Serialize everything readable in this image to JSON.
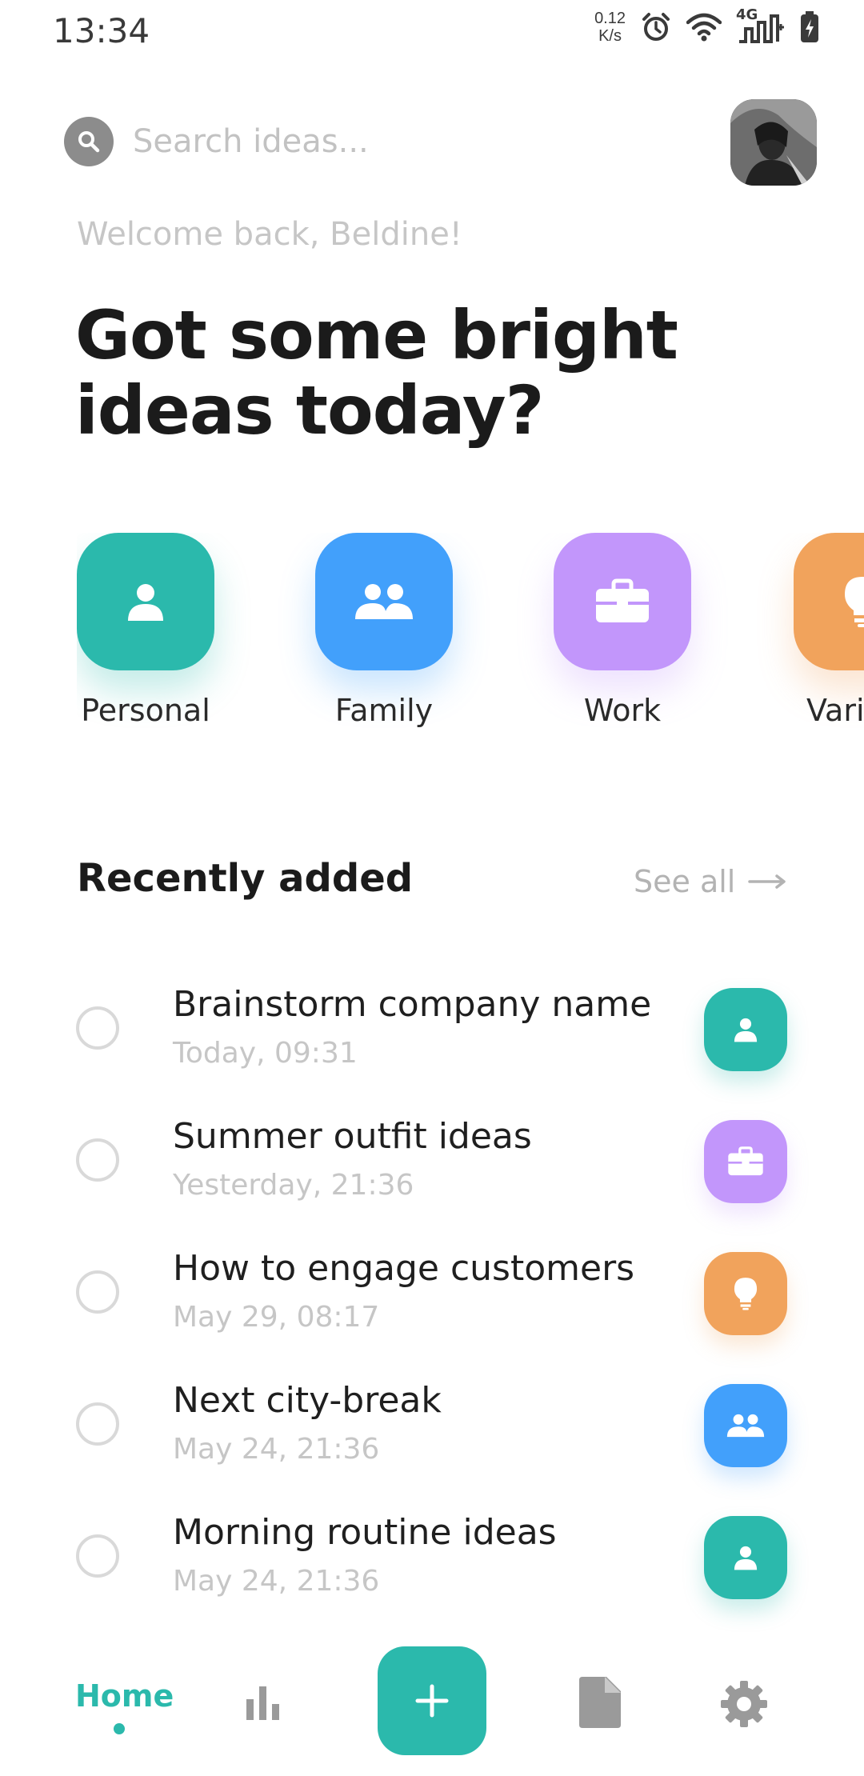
{
  "status_bar": {
    "time": "13:34",
    "net_speed_value": "0.12",
    "net_speed_unit": "K/s",
    "network_type": "4G",
    "icons": [
      "alarm-icon",
      "wifi-icon",
      "signal-icon",
      "battery-icon"
    ]
  },
  "search": {
    "placeholder": "Search ideas..."
  },
  "greeting": "Welcome back, Beldine!",
  "headline": "Got some bright ideas today?",
  "categories": [
    {
      "label": "Personal",
      "icon": "person-icon",
      "color": "#2bb9ac"
    },
    {
      "label": "Family",
      "icon": "people-icon",
      "color": "#42a0fb"
    },
    {
      "label": "Work",
      "icon": "briefcase-icon",
      "color": "#c296fb"
    },
    {
      "label": "Vari",
      "icon": "lightbulb-icon",
      "color": "#f1a35c"
    }
  ],
  "recent": {
    "title": "Recently added",
    "see_all": "See all",
    "items": [
      {
        "title": "Brainstorm company name",
        "time": "Today, 09:31",
        "category": "Personal"
      },
      {
        "title": "Summer outfit ideas",
        "time": "Yesterday, 21:36",
        "category": "Work"
      },
      {
        "title": "How to engage customers",
        "time": "May 29, 08:17",
        "category": "Vari"
      },
      {
        "title": "Next city-break",
        "time": "May 24, 21:36",
        "category": "Family"
      },
      {
        "title": "Morning routine ideas",
        "time": "May 24, 21:36",
        "category": "Personal"
      }
    ]
  },
  "nav": {
    "home_label": "Home",
    "items": [
      "home",
      "stats-icon",
      "add-icon",
      "document-icon",
      "settings-icon"
    ]
  },
  "colors": {
    "accent": "#2bb9ac",
    "personal": "#2bb9ac",
    "family": "#42a0fb",
    "work": "#c296fb",
    "vari": "#f1a35c"
  }
}
